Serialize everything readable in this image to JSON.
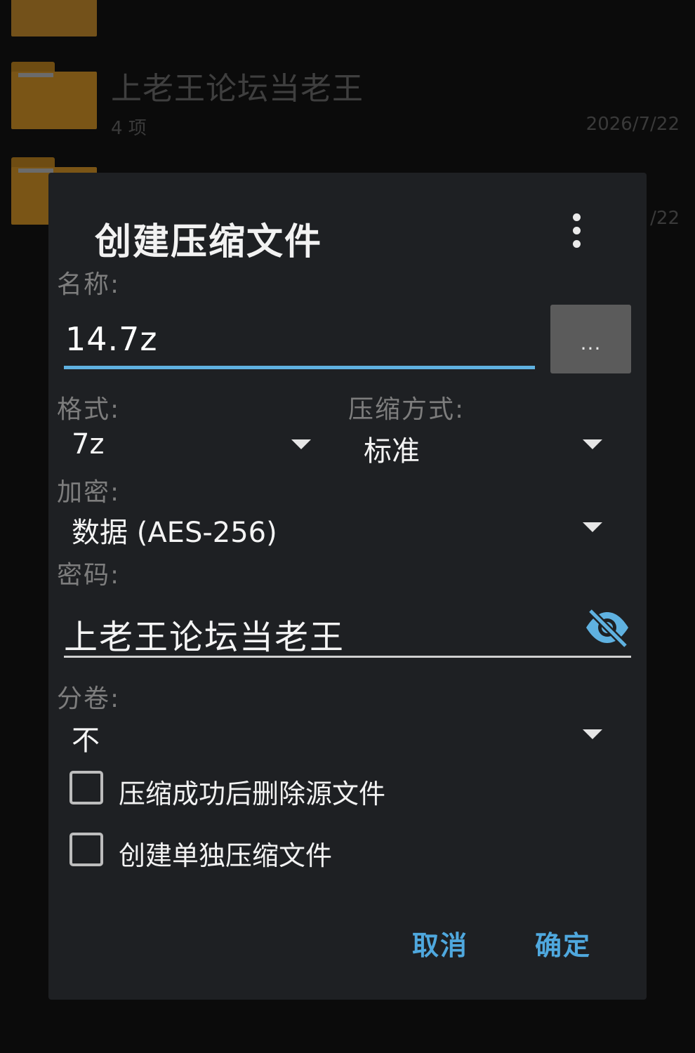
{
  "background_list": {
    "items": [
      {
        "name": "",
        "meta": "",
        "date": ""
      },
      {
        "name": "上老王论坛当老王",
        "meta": "4 项",
        "date": "2026/7/22"
      },
      {
        "name": "",
        "meta": "",
        "date": "/22"
      }
    ]
  },
  "dialog": {
    "title": "创建压缩文件",
    "menu_icon": "more-vert-icon",
    "name_label": "名称:",
    "name_value": "14.7z",
    "browse_label": "...",
    "format_label": "格式:",
    "format_value": "7z",
    "method_label": "压缩方式:",
    "method_value": "标准",
    "encryption_label": "加密:",
    "encryption_value": "数据 (AES-256)",
    "password_label": "密码:",
    "password_value": "上老王论坛当老王",
    "visibility_icon": "visibility-off-icon",
    "split_label": "分卷:",
    "split_value": "不",
    "checkboxes": [
      {
        "label": "压缩成功后删除源文件",
        "checked": false
      },
      {
        "label": "创建单独压缩文件",
        "checked": false
      }
    ],
    "cancel_label": "取消",
    "ok_label": "确定"
  },
  "colors": {
    "accent": "#5fb1e0",
    "dialog_bg": "#1e2023",
    "folder": "#7a5516"
  }
}
